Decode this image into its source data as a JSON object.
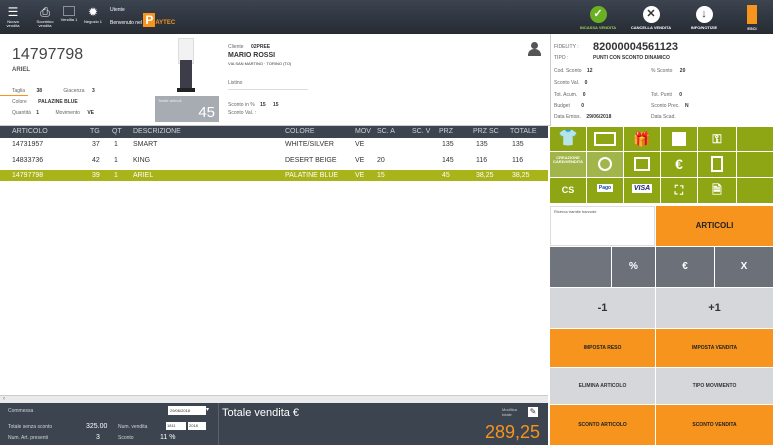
{
  "toolbar": {
    "left_buttons": [
      {
        "label": "Nuova vendita",
        "icon": "list-icon"
      },
      {
        "label": "Scontrino vendita",
        "icon": "printer-icon"
      },
      {
        "label": "Vendita 1",
        "icon": "terminal-icon"
      },
      {
        "label": "Negozio 1",
        "icon": "gear-icon"
      }
    ],
    "user_line1": "Utente",
    "user_line2": "Benvenuto nel",
    "brand_letter": "P",
    "brand_name": "AYTEC",
    "right_buttons": [
      {
        "label": "INCASSA VENDITA",
        "color": "#6ab023",
        "glyph": "✓"
      },
      {
        "label": "CANCELLA VENDITA",
        "color": "#ffffff",
        "glyph": "✕"
      },
      {
        "label": "INFO/NOTIZIE",
        "color": "#ffffff",
        "glyph": "↓"
      },
      {
        "label": "ESCI",
        "color": "#f7941d",
        "glyph": ""
      }
    ]
  },
  "article": {
    "code": "14797798",
    "short": "ARIEL",
    "taglia_label": "Taglia",
    "taglia": "38",
    "giacenza_label": "Giacenza",
    "giacenza": "3",
    "colore_label": "Colore",
    "colore": "PALAZINE BLUE",
    "quantita_label": "Quantità",
    "quantita": "1",
    "movimento_label": "Movimento",
    "movimento": "VE",
    "totale_label": "Totale articoli",
    "totale": "45"
  },
  "client": {
    "label": "Cliente",
    "code": "02PREE",
    "name": "MARIO ROSSI",
    "address": "VIA SAN MARTINO · TORINO (TO)",
    "extra": "Listino",
    "sconto_label": "Sconto in %",
    "sconto1": "15",
    "sconto2": "15",
    "sconto_val_label": "Sconto Val. :"
  },
  "card": {
    "fidelity_label": "FIDELITY :",
    "fidelity": "82000004561123",
    "tipo_label": "TIPO :",
    "tipo": "PUNTI CON SCONTO DINAMICO",
    "cod_sconto_label": "Cod. Sconto",
    "cod_sconto": "12",
    "perc_sconto_label": "% Sconto",
    "perc_sconto": "20",
    "sconto_val_label": "Sconto Val.",
    "sconto_val": "0",
    "tot_acum_label": "Tot. Acum.",
    "tot_acum": "0",
    "tot_punti_label": "Tot. Punti",
    "tot_punti": "0",
    "budget_label": "Budget",
    "budget": "0",
    "sconto_prec_label": "Sconto Prec.",
    "sconto_prec": "N",
    "data_emiss_label": "Data Emiss.",
    "data_emiss": "29/06/2018",
    "data_scad_label": "Data Scad."
  },
  "grid": {
    "headers": [
      "ARTICOLO",
      "TG",
      "QT",
      "DESCRIZIONE",
      "COLORE",
      "MOV",
      "SC. A",
      "SC. V",
      "PRZ",
      "PRZ SC",
      "TOTALE"
    ],
    "rows": [
      [
        "14731957",
        "37",
        "1",
        "SMART",
        "WHITE/SILVER",
        "VE",
        "",
        "",
        "135",
        "135",
        "135"
      ],
      [
        "14833736",
        "42",
        "1",
        "KING",
        "DESERT BEIGE",
        "VE",
        "20",
        "",
        "145",
        "116",
        "116"
      ],
      [
        "14797798",
        "39",
        "1",
        "ARIEL",
        "PALATINE BLUE",
        "VE",
        "15",
        "",
        "45",
        "38,25",
        "38,25"
      ]
    ]
  },
  "tiles": {
    "creazione_label": "CREAZIONE CARD/VENDITA"
  },
  "buttons": {
    "ricerca_label": "Ricerca tramite barcode",
    "articoli": "ARTICOLI",
    "percent": "%",
    "euro": "€",
    "x": "X",
    "minus": "-1",
    "plus": "+1",
    "imposta_reso": "IMPOSTA RESO",
    "imposta_vendita": "IMPOSTA VENDITA",
    "elimina": "ELIMINA ARTICOLO",
    "tipo_mov": "TIPO MOVIMENTO",
    "sconto_art": "SCONTO ARTICOLO",
    "sconto_vend": "SCONTO VENDITA"
  },
  "footer": {
    "commessa_label": "Commessa",
    "date": "29/06/2018",
    "tot_senza_label": "Totale senza sconto",
    "tot_senza": "325.00",
    "num_vendita_label": "Num. vendita",
    "num_vendita": "1811",
    "year": "2018",
    "num_art_label": "Num. Art. presenti",
    "num_art": "3",
    "sconto_label": "Sconto",
    "sconto": "11 %",
    "totale_label": "Totale vendita €",
    "modifica_label": "Modifica totale",
    "totale": "289,25"
  }
}
